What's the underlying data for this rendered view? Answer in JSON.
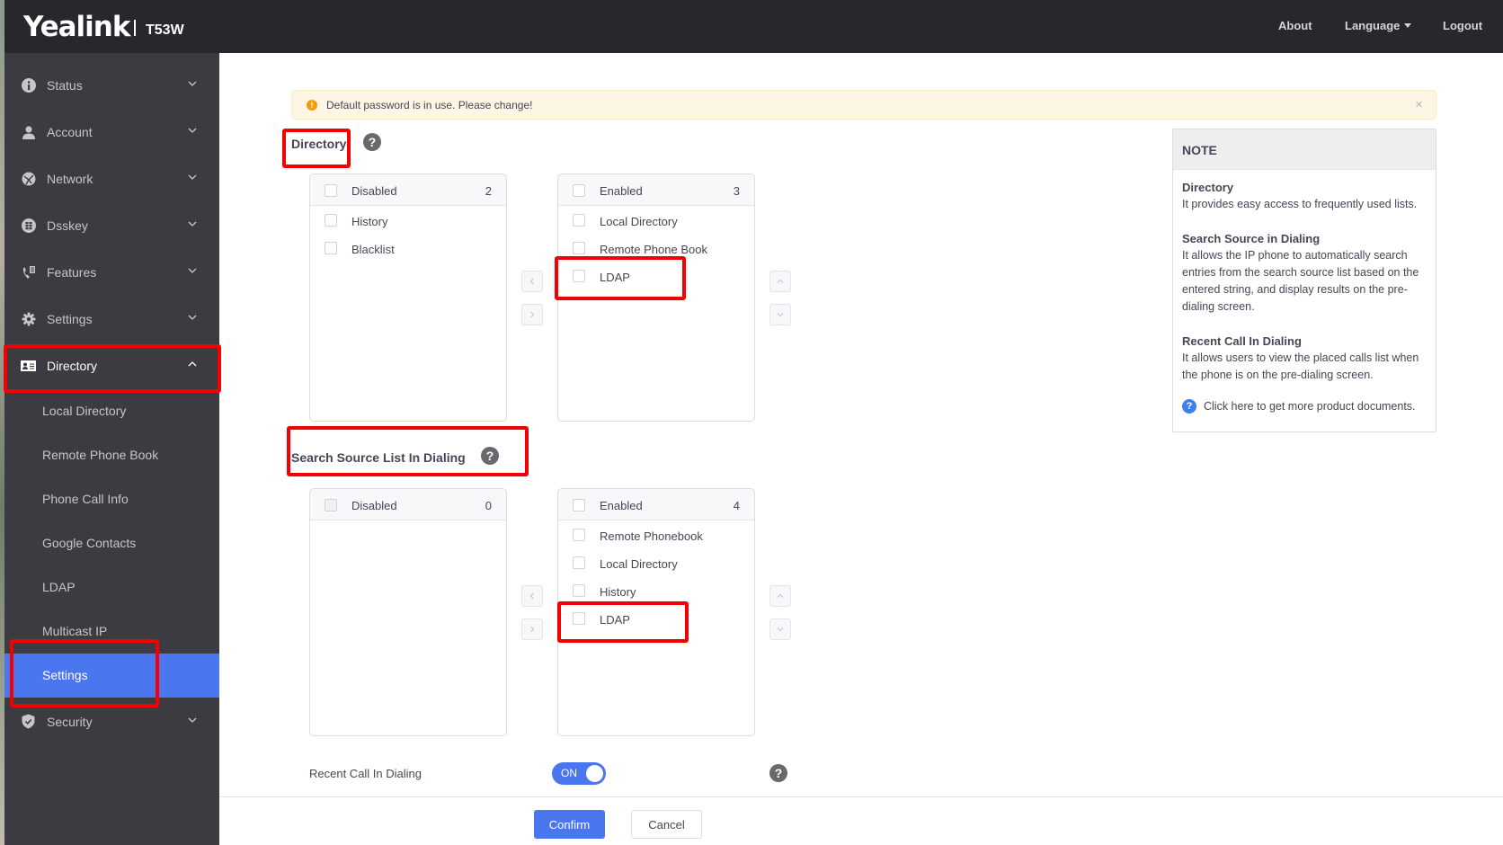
{
  "header": {
    "brand": "Yealink",
    "model": "T53W",
    "nav": [
      {
        "label": "About"
      },
      {
        "label": "Language"
      },
      {
        "label": "Logout"
      }
    ]
  },
  "sidebar": {
    "items": [
      {
        "label": "Status",
        "icon": "info-icon",
        "expanded": false
      },
      {
        "label": "Account",
        "icon": "user-icon",
        "expanded": false
      },
      {
        "label": "Network",
        "icon": "globe-icon",
        "expanded": false
      },
      {
        "label": "Dsskey",
        "icon": "grid-icon",
        "expanded": false
      },
      {
        "label": "Features",
        "icon": "phone-features-icon",
        "expanded": false
      },
      {
        "label": "Settings",
        "icon": "gear-icon",
        "expanded": false
      },
      {
        "label": "Directory",
        "icon": "contact-card-icon",
        "expanded": true
      },
      {
        "label": "Security",
        "icon": "shield-icon",
        "expanded": false
      }
    ],
    "directory_subitems": [
      {
        "label": "Local Directory"
      },
      {
        "label": "Remote Phone Book"
      },
      {
        "label": "Phone Call Info"
      },
      {
        "label": "Google Contacts"
      },
      {
        "label": "LDAP"
      },
      {
        "label": "Multicast IP"
      },
      {
        "label": "Settings",
        "active": true
      }
    ]
  },
  "alert": {
    "text": "Default password is in use. Please change!",
    "icon": "warning-icon"
  },
  "directory": {
    "title": "Directory",
    "disabled": {
      "label": "Disabled",
      "count": "2",
      "items": [
        "History",
        "Blacklist"
      ]
    },
    "enabled": {
      "label": "Enabled",
      "count": "3",
      "items": [
        "Local Directory",
        "Remote Phone Book",
        "LDAP"
      ]
    }
  },
  "search_source": {
    "title": "Search Source List In Dialing",
    "disabled": {
      "label": "Disabled",
      "count": "0",
      "items": []
    },
    "enabled": {
      "label": "Enabled",
      "count": "4",
      "items": [
        "Remote Phonebook",
        "Local Directory",
        "History",
        "LDAP"
      ]
    }
  },
  "recent_call": {
    "label": "Recent Call In Dialing",
    "toggle_text": "ON",
    "value": true
  },
  "buttons": {
    "confirm": "Confirm",
    "cancel": "Cancel"
  },
  "note": {
    "title": "NOTE",
    "sections": [
      {
        "heading": "Directory",
        "text": "It provides easy access to frequently used lists."
      },
      {
        "heading": "Search Source in Dialing",
        "text": "It allows the IP phone to automatically search entries from the search source list based on the entered string, and display results on the pre-dialing screen."
      },
      {
        "heading": "Recent Call In Dialing",
        "text": "It allows users to view the placed calls list when the phone is on the pre-dialing screen."
      }
    ],
    "link": "Click here to get more product documents."
  },
  "colors": {
    "accent": "#4a76f0",
    "header_bg": "#27282c",
    "sidebar_bg": "#3b3b41",
    "highlight_box": "#f40000",
    "alert_bg": "#fef6e4"
  }
}
